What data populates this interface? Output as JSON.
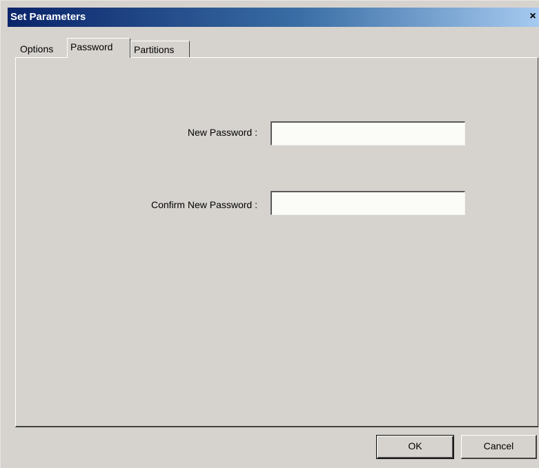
{
  "window": {
    "title": "Set Parameters",
    "close_glyph": "×"
  },
  "tabs": [
    {
      "label": "Options",
      "active": false
    },
    {
      "label": "Password",
      "active": true
    },
    {
      "label": "Partitions",
      "active": false
    }
  ],
  "form": {
    "new_password": {
      "label": "New Password :",
      "value": ""
    },
    "confirm_password": {
      "label": "Confirm New Password :",
      "value": ""
    }
  },
  "buttons": {
    "ok_label": "OK",
    "cancel_label": "Cancel"
  },
  "colors": {
    "titlebar_start": "#0a246a",
    "titlebar_end": "#a6caf0",
    "dialog_face": "#d6d3ce"
  }
}
